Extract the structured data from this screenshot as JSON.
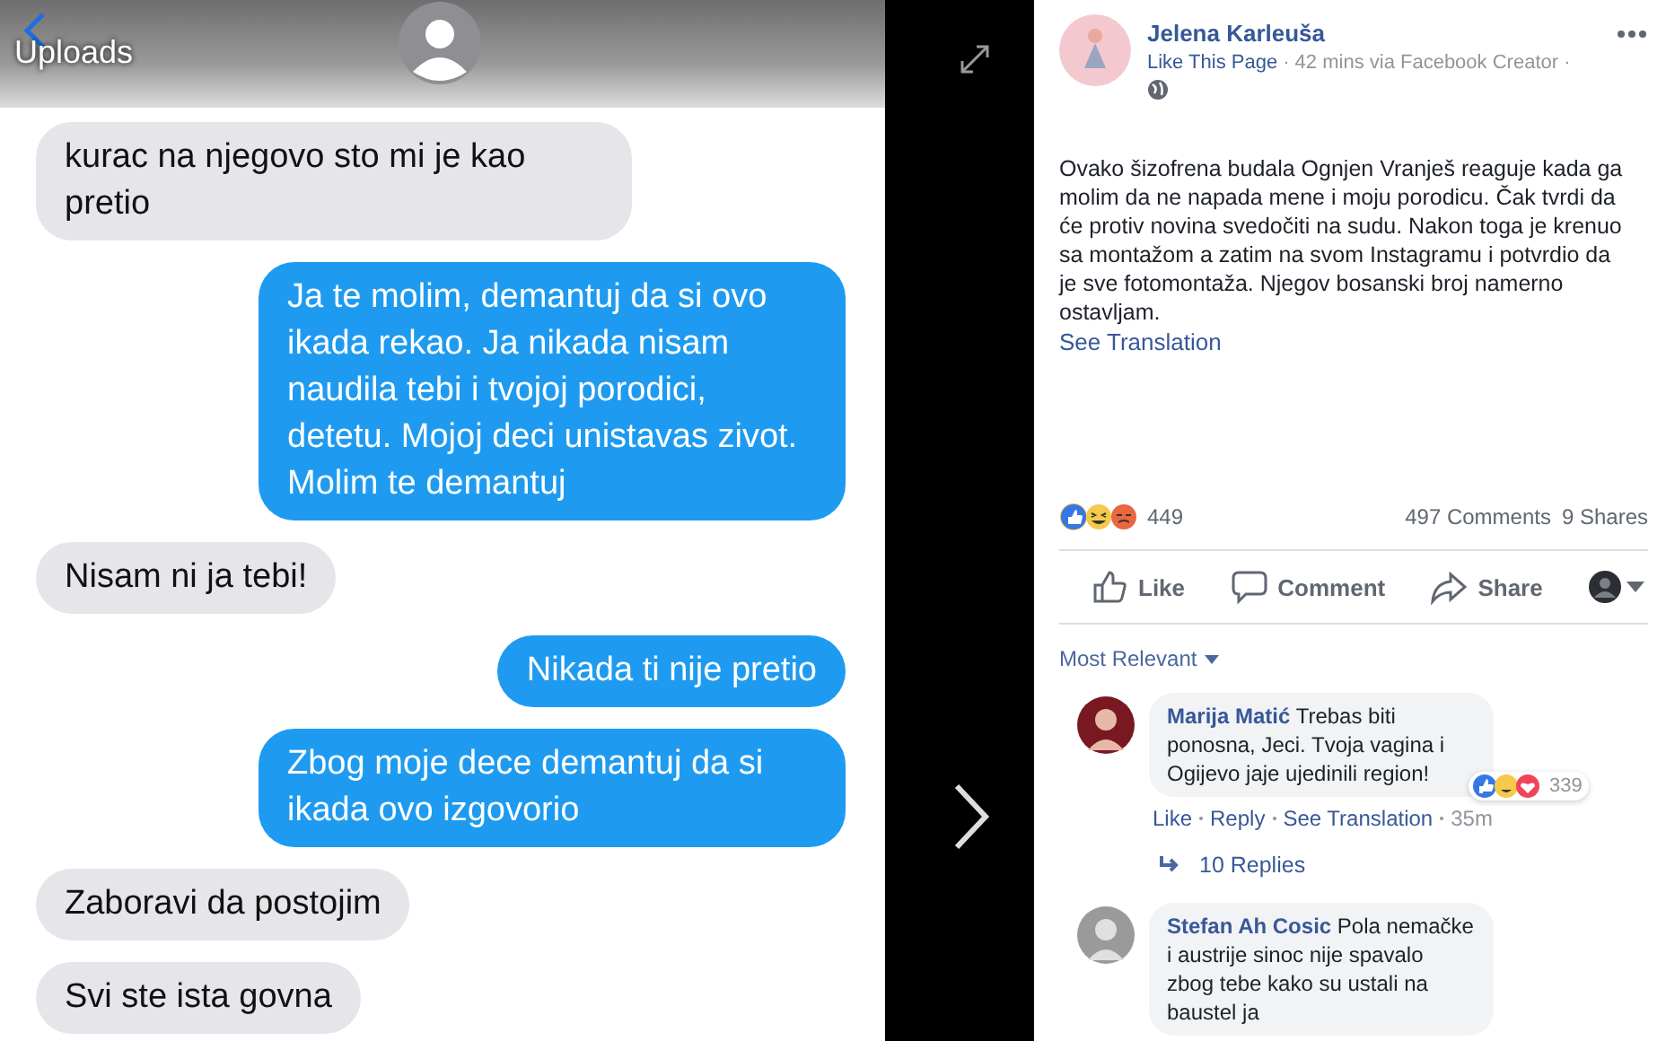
{
  "viewer": {
    "album_title": "Uploads",
    "messages": [
      {
        "kind": "received",
        "text": "kurac na njegovo sto mi je kao pretio"
      },
      {
        "kind": "sent",
        "text": "Ja te molim, demantuj da si ovo ikada rekao. Ja nikada nisam naudila tebi i tvojoj porodici, detetu. Mojoj deci unistavas zivot. Molim te demantuj"
      },
      {
        "kind": "received",
        "text": "Nisam ni ja tebi!"
      },
      {
        "kind": "sent",
        "text": "Nikada ti nije pretio"
      },
      {
        "kind": "sent",
        "text": "Zbog moje dece demantuj da si ikada ovo izgovorio"
      },
      {
        "kind": "received",
        "text": "Zaboravi da postojim"
      },
      {
        "kind": "received",
        "text": "Svi ste ista govna"
      }
    ]
  },
  "post": {
    "author": "Jelena Karleuša",
    "like_page": "Like This Page",
    "meta": "· 42 mins via Facebook Creator ·",
    "body": "Ovako šizofrena budala Ognjen Vranješ reaguje kada ga molim da ne napada mene i moju porodicu. Čak tvrdi da će protiv novina svedočiti na sudu. Nakon toga je krenuo sa montažom a zatim na svom Instagramu i potvrdio da je sve fotomontaža. Njegov bosanski broj namerno ostavljam.",
    "see_translation": "See Translation",
    "reactions_count": "449",
    "comments_count": "497 Comments",
    "shares_count": "9 Shares",
    "actions": [
      {
        "kind": "like",
        "label": "Like"
      },
      {
        "kind": "comment",
        "label": "Comment"
      },
      {
        "kind": "share",
        "label": "Share"
      }
    ],
    "sort": "Most Relevant",
    "comments": [
      {
        "author": "Marija Matić",
        "text": "Trebas biti ponosna, Jeci. Tvoja vagina i Ogijevo jaje ujedinili region!",
        "reactions_count": "339",
        "links": [
          "Like",
          "Reply",
          "See Translation"
        ],
        "time": "35m",
        "replies": "10 Replies"
      },
      {
        "author": "Stefan Ah Cosic",
        "text": "Pola nemačke i austrije sinoc nije spavalo zbog tebe kako su ustali na baustel ja"
      }
    ]
  }
}
